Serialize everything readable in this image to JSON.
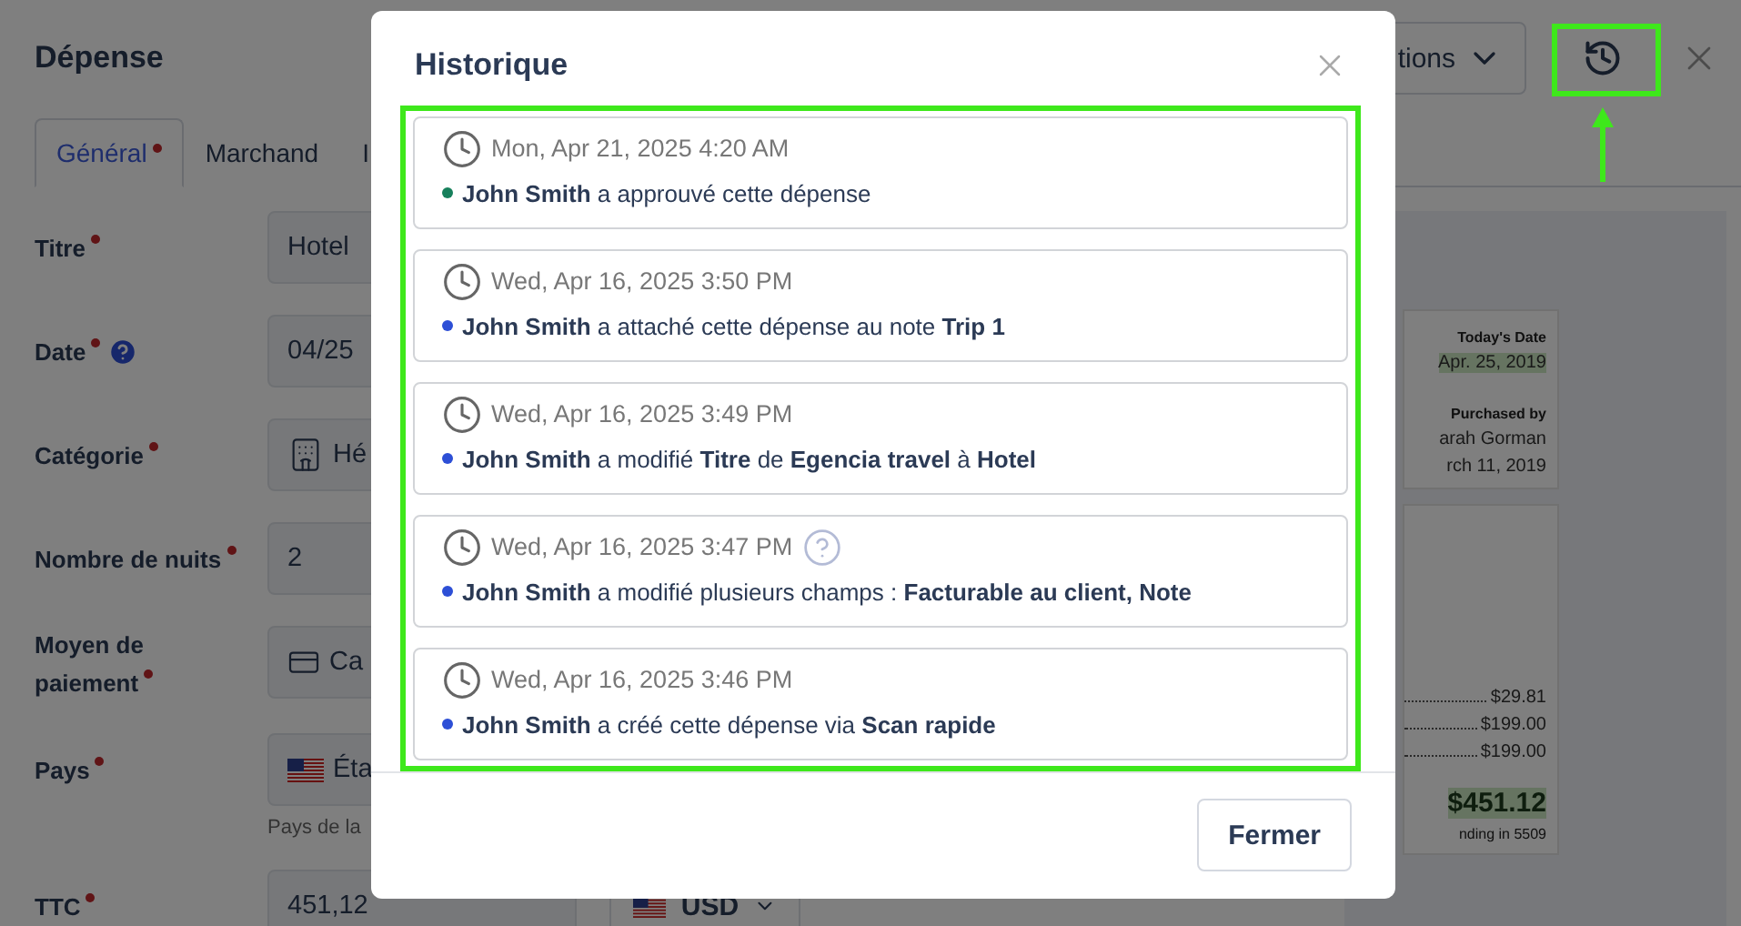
{
  "page": {
    "title": "Dépense",
    "actions_label": "tions",
    "tabs": [
      {
        "label": "Général",
        "required": true,
        "selected": true
      },
      {
        "label": "Marchand",
        "required": false,
        "selected": false
      },
      {
        "label": "I",
        "required": false,
        "selected": false
      }
    ],
    "fields": [
      {
        "kind": "text",
        "label": "Titre",
        "required": true,
        "value": "Hotel"
      },
      {
        "kind": "text",
        "label": "Date",
        "required": true,
        "help": true,
        "value": "04/25"
      },
      {
        "kind": "category",
        "label": "Catégorie",
        "required": true,
        "value": "Hé"
      },
      {
        "kind": "text",
        "label": "Nombre de nuits",
        "required": true,
        "value": "2"
      },
      {
        "kind": "payment",
        "label": "Moyen de paiement",
        "required": true,
        "value": "Ca"
      },
      {
        "kind": "country",
        "label": "Pays",
        "required": true,
        "value": "Éta",
        "hint": "Pays de la"
      },
      {
        "kind": "amount",
        "label": "TTC",
        "required": true,
        "value": "451,12",
        "currency": "USD"
      }
    ],
    "receipt": {
      "date_label": "Today's Date",
      "date": "Apr. 25, 2019",
      "purchased_label": "Purchased by",
      "purchaser": "arah Gorman",
      "purchase_date": "rch 11, 2019",
      "lines": [
        "$29.81",
        "$199.00",
        "$199.00"
      ],
      "total": "$451.12",
      "card": "nding in 5509"
    }
  },
  "dialog": {
    "title": "Historique",
    "close_button": "Fermer",
    "entries": [
      {
        "time": "Mon, Apr 21, 2025 4:20 AM",
        "help": false,
        "color": "#17805c",
        "text": "**John Smith** a approuvé cette dépense"
      },
      {
        "time": "Wed, Apr 16, 2025 3:50 PM",
        "help": false,
        "color": "#2d4fd6",
        "text": "**John Smith** a attaché cette dépense au note **Trip 1**"
      },
      {
        "time": "Wed, Apr 16, 2025 3:49 PM",
        "help": false,
        "color": "#2d4fd6",
        "text": "**John Smith** a modifié **Titre** de **Egencia travel** à **Hotel**"
      },
      {
        "time": "Wed, Apr 16, 2025 3:47 PM",
        "help": true,
        "color": "#2d4fd6",
        "text": "**John Smith** a modifié plusieurs champs : **Facturable au client, Note**"
      },
      {
        "time": "Wed, Apr 16, 2025 3:46 PM",
        "help": false,
        "color": "#2d4fd6",
        "text": "**John Smith** a créé cette dépense via **Scan rapide**"
      }
    ]
  }
}
